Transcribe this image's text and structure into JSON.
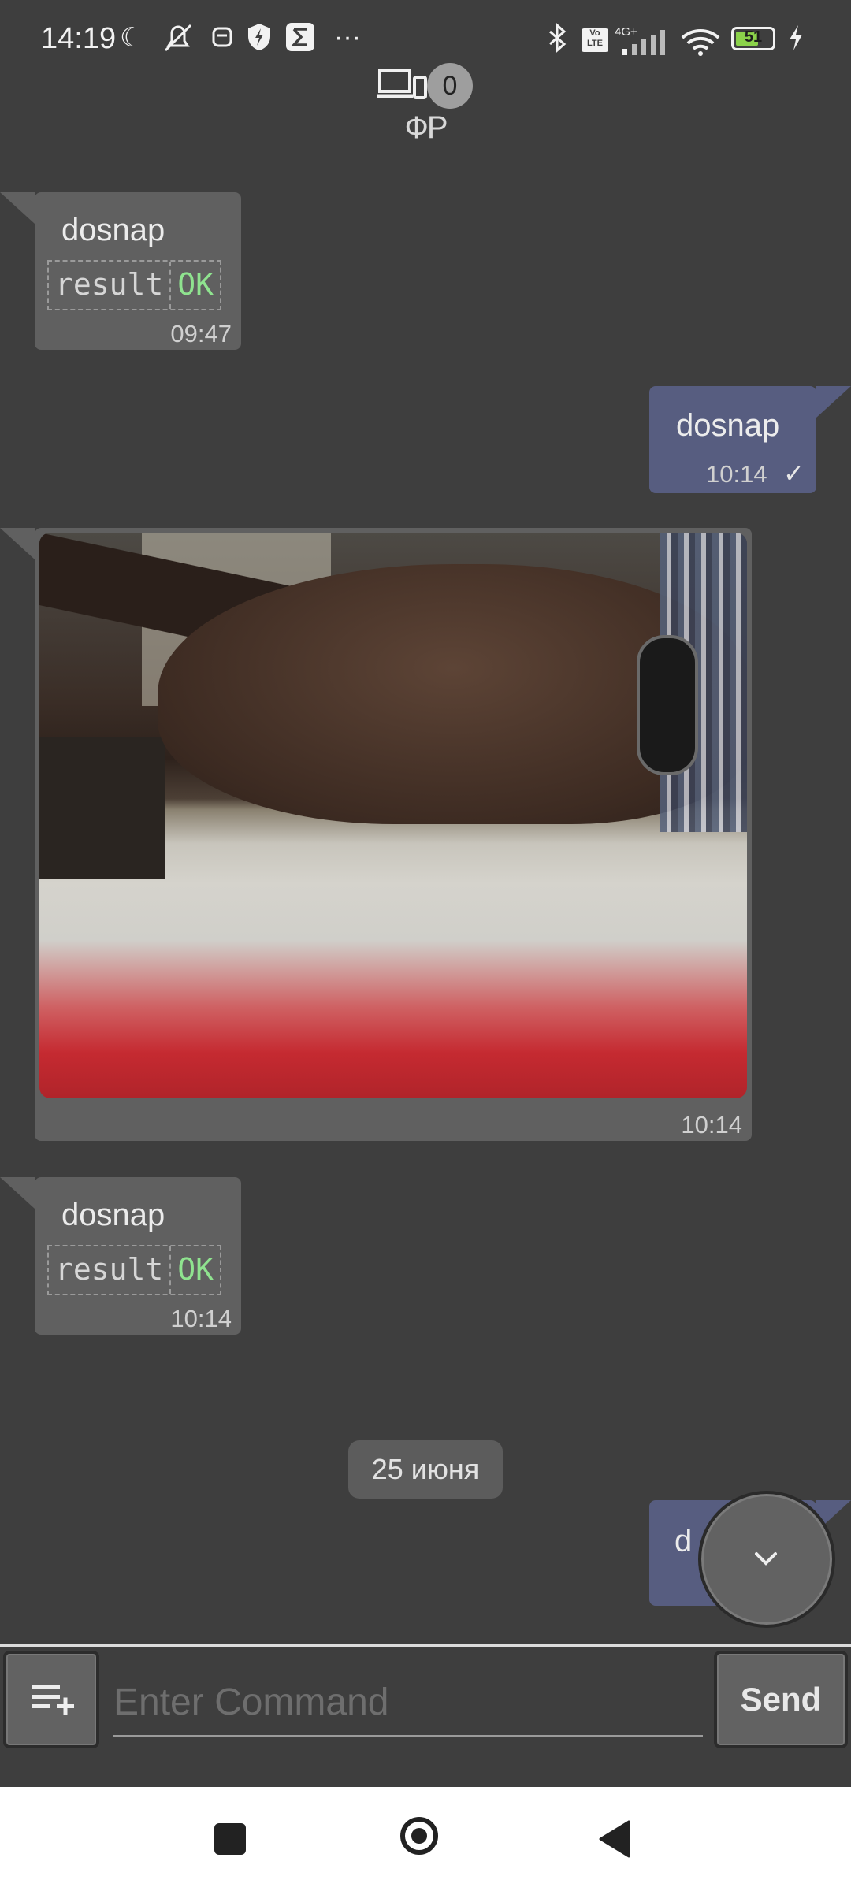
{
  "status_bar": {
    "time": "14:19",
    "dots": "···",
    "network": "4G+",
    "volte": "Vo LTE",
    "battery": "51"
  },
  "header": {
    "device_count": "0",
    "device_name": "ФР"
  },
  "messages": [
    {
      "direction": "in",
      "text": "dosnap",
      "result_key": "result",
      "result_value": "OK",
      "time": "09:47"
    },
    {
      "direction": "out",
      "text": "dosnap",
      "time": "10:14",
      "status": "✓"
    },
    {
      "direction": "in",
      "type": "image",
      "time": "10:14"
    },
    {
      "direction": "in",
      "text": "dosnap",
      "result_key": "result",
      "result_value": "OK",
      "time": "10:14"
    },
    {
      "direction": "out",
      "text": "d",
      "partial": true
    }
  ],
  "date_separator": "25 июня",
  "input": {
    "placeholder": "Enter Command",
    "value": "",
    "send_label": "Send"
  },
  "colors": {
    "background": "#3e3e3e",
    "bubble_in": "#606060",
    "bubble_out": "#575d80",
    "ok_green": "#8fe38f"
  }
}
